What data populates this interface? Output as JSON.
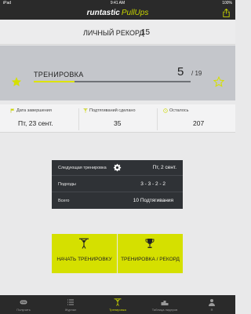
{
  "status_bar": {
    "carrier": "iPad",
    "time": "9:41 AM",
    "battery": "100%"
  },
  "app": {
    "brand_part1": "runtastic",
    "brand_part2": "PullUps"
  },
  "record": {
    "label": "ЛИЧНЫЙ РЕКОРД",
    "value": "15"
  },
  "training": {
    "title": "ТРЕНИРОВКА",
    "current": "5",
    "total": "/ 19",
    "progress": 0.26
  },
  "stats": [
    {
      "label": "Дата завершения",
      "value": "Пт, 23 сент.",
      "icon": "flag-icon"
    },
    {
      "label": "Подтягиваний сделано",
      "value": "35",
      "icon": "pullup-icon"
    },
    {
      "label": "Осталось",
      "value": "207",
      "icon": "clock-icon"
    }
  ],
  "next_training": {
    "label": "Следующая тренировка",
    "value": "Пт, 2 сент.",
    "rows": [
      {
        "label": "Подходы",
        "value": "3 - 3 - 2 - 2"
      },
      {
        "label": "Всего",
        "value": "10 Подтягивания"
      }
    ]
  },
  "buttons": {
    "start": "НАЧАТЬ ТРЕНИРОВКУ",
    "record": "ТРЕНИРОВКА / РЕКОРД"
  },
  "tabs": [
    {
      "label": "Получить",
      "icon": "pro-icon",
      "active": false
    },
    {
      "label": "Журнал",
      "icon": "list-icon",
      "active": false
    },
    {
      "label": "Тренировка",
      "icon": "pullup-icon",
      "active": true
    },
    {
      "label": "Таблица лидеров",
      "icon": "podium-icon",
      "active": false
    },
    {
      "label": "Я",
      "icon": "person-icon",
      "active": false
    }
  ],
  "colors": {
    "accent": "#d5e000",
    "dark": "#2a2a2a"
  }
}
